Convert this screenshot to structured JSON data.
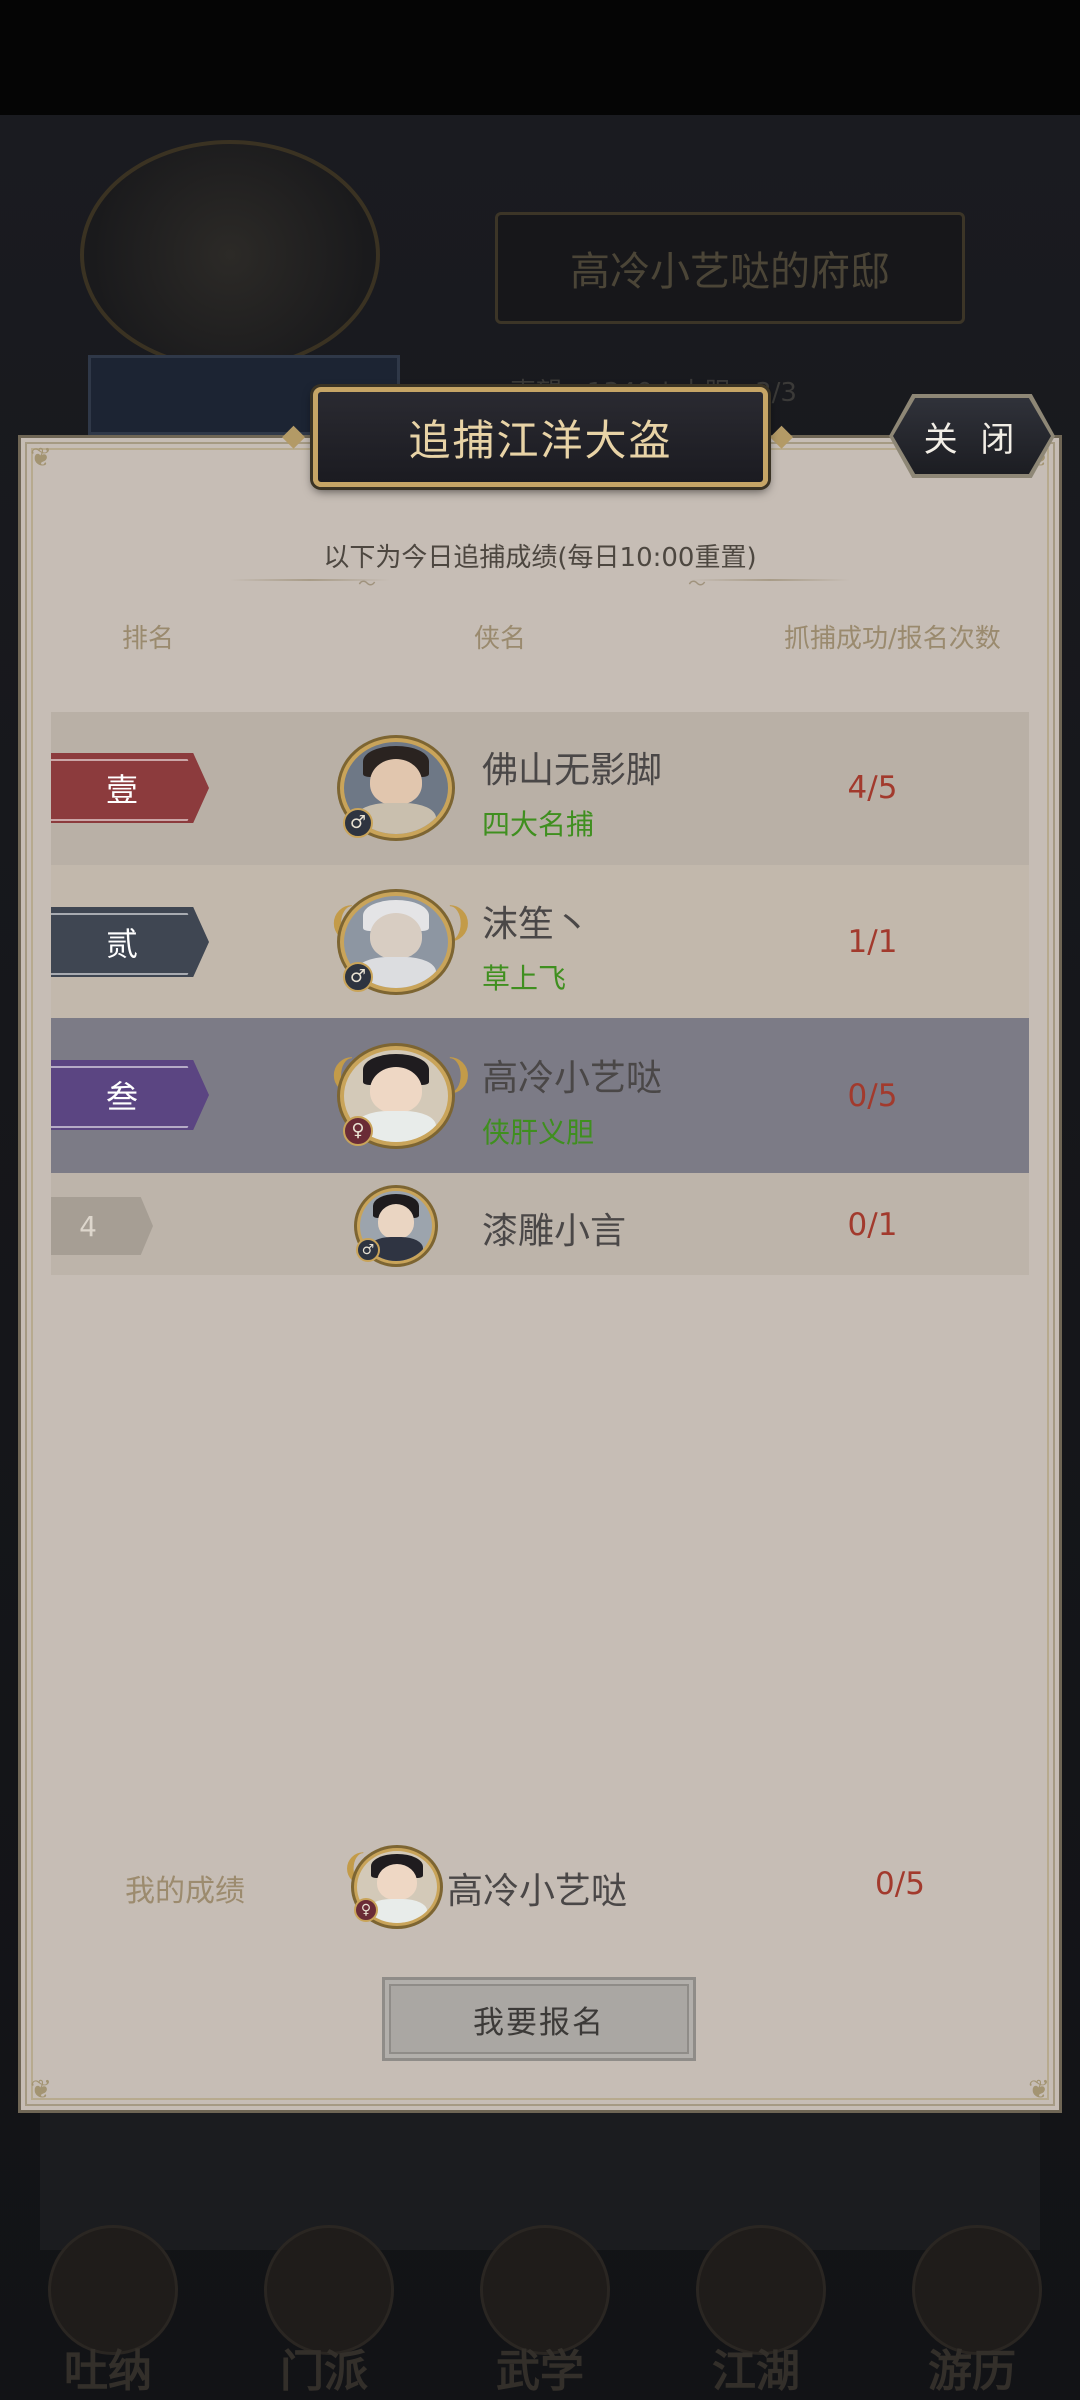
{
  "background": {
    "house_title": "高冷小艺哒的府邸",
    "sub_info": "声望 · 1340 | 本服 · 3/3",
    "nav": [
      "吐纳",
      "门派",
      "武学",
      "江湖",
      "游历"
    ]
  },
  "dialog": {
    "title": "追捕江洋大盗",
    "close_label": "关 闭",
    "subtitle": "以下为今日追捕成绩(每日10:00重置)",
    "columns": {
      "rank": "排名",
      "name": "侠名",
      "score": "抓捕成功/报名次数"
    }
  },
  "rankings": [
    {
      "rank": "壹",
      "name": "佛山无影脚",
      "title": "四大名捕",
      "score": "4/5",
      "gender": "♂",
      "tag_color": "#8c3b3d"
    },
    {
      "rank": "贰",
      "name": "沫笙丶",
      "title": "草上飞",
      "score": "1/1",
      "gender": "♂",
      "tag_color": "#3f4652"
    },
    {
      "rank": "叁",
      "name": "高冷小艺哒",
      "title": "侠肝义胆",
      "score": "0/5",
      "gender": "♀",
      "tag_color": "#5b4582"
    },
    {
      "rank": "4",
      "name": "漆雕小言",
      "title": "",
      "score": "0/1",
      "gender": "♂"
    }
  ],
  "my_record": {
    "label": "我的成绩",
    "name": "高冷小艺哒",
    "score": "0/5",
    "gender": "♀"
  },
  "signup_button": "我要报名",
  "colors": {
    "panel_bg": "#c6bdb5",
    "highlight_row": "#7c7b86",
    "score_red": "#a23a2d",
    "title_green": "#3f8f1f",
    "gold": "#c9a45a"
  }
}
